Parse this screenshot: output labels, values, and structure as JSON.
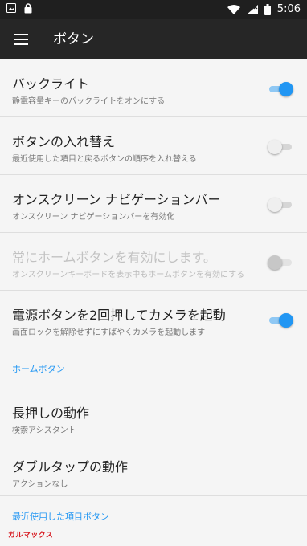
{
  "status_bar": {
    "time": "5:06",
    "left_icons": [
      "image-icon",
      "lock-icon"
    ],
    "right_icons": [
      "wifi-icon",
      "signal-icon",
      "battery-icon"
    ]
  },
  "header": {
    "title": "ボタン",
    "menu_icon": "menu-icon"
  },
  "settings": [
    {
      "id": "backlight",
      "title": "バックライト",
      "subtitle": "静電容量キーのバックライトをオンにする",
      "enabled": true,
      "toggle": "on"
    },
    {
      "id": "swap",
      "title": "ボタンの入れ替え",
      "subtitle": "最近使用した項目と戻るボタンの順序を入れ替える",
      "enabled": true,
      "toggle": "off"
    },
    {
      "id": "onscreen",
      "title": "オンスクリーン ナビゲーションバー",
      "subtitle": "オンスクリーン ナビゲーションバーを有効化",
      "enabled": true,
      "toggle": "off"
    },
    {
      "id": "home-always",
      "title": "常にホームボタンを有効にします。",
      "subtitle": "オンスクリーンキーボードを表示中もホームボタンを有効にする",
      "enabled": false,
      "toggle": "off"
    },
    {
      "id": "camera",
      "title": "電源ボタンを2回押してカメラを起動",
      "subtitle": "画面ロックを解除せずにすばやくカメラを起動します",
      "enabled": true,
      "toggle": "on"
    }
  ],
  "home_section": {
    "label": "ホームボタン",
    "items": [
      {
        "title": "長押しの動作",
        "subtitle": "検索アシスタント"
      },
      {
        "title": "ダブルタップの動作",
        "subtitle": "アクションなし"
      }
    ]
  },
  "recent_section": {
    "label": "最近使用した項目ボタン"
  },
  "watermark": "ガルマックス",
  "colors": {
    "accent": "#2196f3",
    "background": "#f5f5f5",
    "appbar": "#262626",
    "statusbar": "#1f1f1f"
  }
}
